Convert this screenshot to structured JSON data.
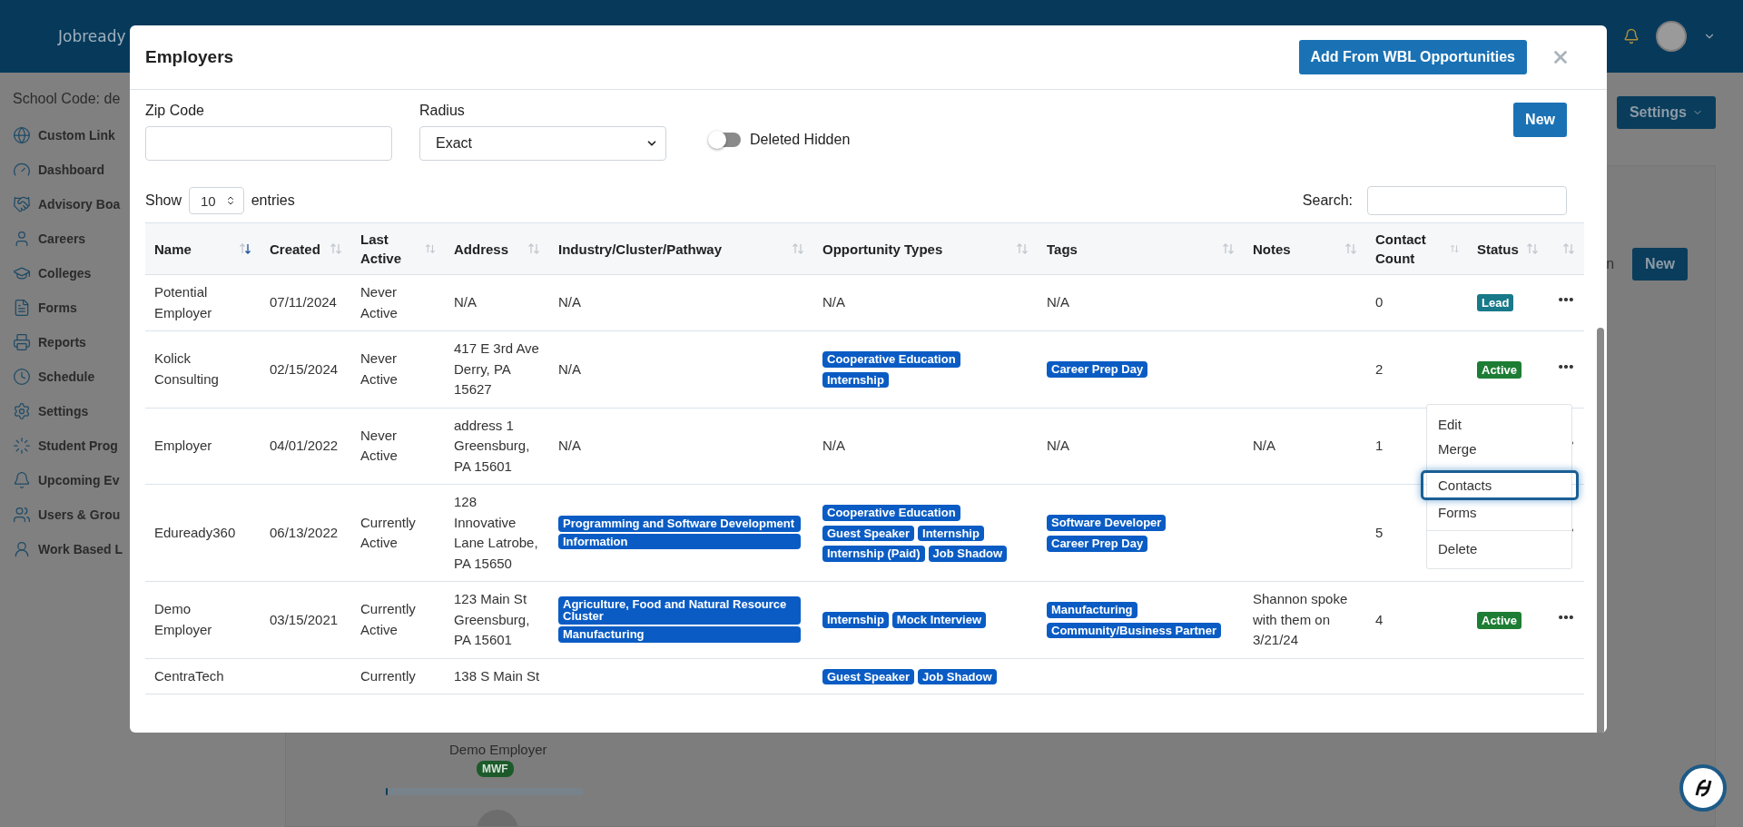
{
  "header": {
    "logo": "Jobready"
  },
  "sidebar": {
    "school_code": "School Code: de",
    "items": [
      {
        "label": "Custom Link"
      },
      {
        "label": "Dashboard"
      },
      {
        "label": "Advisory Boa"
      },
      {
        "label": "Careers"
      },
      {
        "label": "Colleges"
      },
      {
        "label": "Forms"
      },
      {
        "label": "Reports"
      },
      {
        "label": "Schedule"
      },
      {
        "label": "Settings"
      },
      {
        "label": "Student Prog"
      },
      {
        "label": "Upcoming Ev"
      },
      {
        "label": "Users & Grou"
      },
      {
        "label": "Work Based L"
      }
    ]
  },
  "background": {
    "settings_button": "Settings",
    "partial_text": "n",
    "new_button": "New",
    "employer": "Demo Employer",
    "badge": "MWF",
    "progress": {
      "level": 0.01
    }
  },
  "modal": {
    "title": "Employers",
    "add_button": "Add From WBL Opportunities",
    "filters": {
      "zip_label": "Zip Code",
      "radius_label": "Radius",
      "radius_value": "Exact",
      "toggle_label": "Deleted Hidden",
      "toggle_on": false
    },
    "new_button": "New",
    "length": {
      "prefix": "Show",
      "value": "10",
      "suffix": "entries"
    },
    "search_label": "Search:",
    "table": {
      "columns": [
        {
          "label": "Name",
          "sorted": true
        },
        {
          "label": "Created",
          "sorted": false
        },
        {
          "label": "Last Active",
          "sorted": false
        },
        {
          "label": "Address",
          "sorted": false
        },
        {
          "label": "Industry/Cluster/Pathway",
          "sorted": false
        },
        {
          "label": "Opportunity Types",
          "sorted": false
        },
        {
          "label": "Tags",
          "sorted": false
        },
        {
          "label": "Notes",
          "sorted": false
        },
        {
          "label": "Contact Count",
          "sorted": false
        },
        {
          "label": "Status",
          "sorted": false
        },
        {
          "sorted": false
        }
      ],
      "rows": [
        {
          "name": "Potential Employer",
          "created": "07/11/2024",
          "last_active": "Never Active",
          "address": "N/A",
          "industry": "N/A",
          "opportunities": "N/A",
          "tags": "N/A",
          "notes": "",
          "contact_count": "0",
          "status": {
            "label": "Lead",
            "kind": "lead"
          }
        },
        {
          "name": "Kolick Consulting",
          "created": "02/15/2024",
          "last_active": "Never Active",
          "address": "417 E 3rd Ave Derry, PA 15627",
          "industry": "N/A",
          "opportunities": [
            "Cooperative Education",
            "Internship"
          ],
          "tags": [
            "Career Prep Day"
          ],
          "notes": "",
          "contact_count": "2",
          "status": {
            "label": "Active",
            "kind": "active"
          }
        },
        {
          "name": "Employer",
          "created": "04/01/2022",
          "last_active": "Never Active",
          "address": "address 1 Greensburg, PA 15601",
          "industry": "N/A",
          "opportunities": "N/A",
          "tags": "N/A",
          "notes": "N/A",
          "contact_count": "1"
        },
        {
          "name": "Eduready360",
          "created": "06/13/2022",
          "last_active": "Currently Active",
          "address": "128 Innovative Lane Latrobe, PA 15650",
          "industry": [
            "Programming and Software Development",
            "Information"
          ],
          "opportunities": [
            "Cooperative Education",
            "Guest Speaker",
            "Internship",
            "Internship (Paid)",
            "Job Shadow"
          ],
          "tags": [
            "Software Developer",
            "Career Prep Day"
          ],
          "notes": "",
          "contact_count": "5"
        },
        {
          "name": "Demo Employer",
          "created": "03/15/2021",
          "last_active": "Currently Active",
          "address": "123 Main St Greensburg, PA 15601",
          "industry": [
            "Agriculture, Food and Natural Resource Cluster",
            "Manufacturing"
          ],
          "opportunities": [
            "Internship",
            "Mock Interview"
          ],
          "tags": [
            "Manufacturing",
            "Community/Business Partner"
          ],
          "notes": "Shannon spoke with them on 3/21/24",
          "contact_count": "4",
          "status": {
            "label": "Active",
            "kind": "active"
          }
        },
        {
          "name": "CentraTech",
          "created": "",
          "last_active": "Currently",
          "address": "138 S Main St",
          "industry": "",
          "opportunities": [
            "Guest Speaker",
            "Job Shadow"
          ],
          "tags": "",
          "notes": "",
          "contact_count": ""
        }
      ]
    },
    "menu": {
      "groups": [
        {
          "items": [
            {
              "label": "Edit",
              "selected": false
            },
            {
              "label": "Merge",
              "selected": false
            },
            {
              "label": "Contacts",
              "selected": true
            },
            {
              "label": "Forms",
              "selected": false
            }
          ]
        },
        {
          "items": [
            {
              "label": "Delete",
              "selected": false
            }
          ]
        }
      ]
    }
  }
}
